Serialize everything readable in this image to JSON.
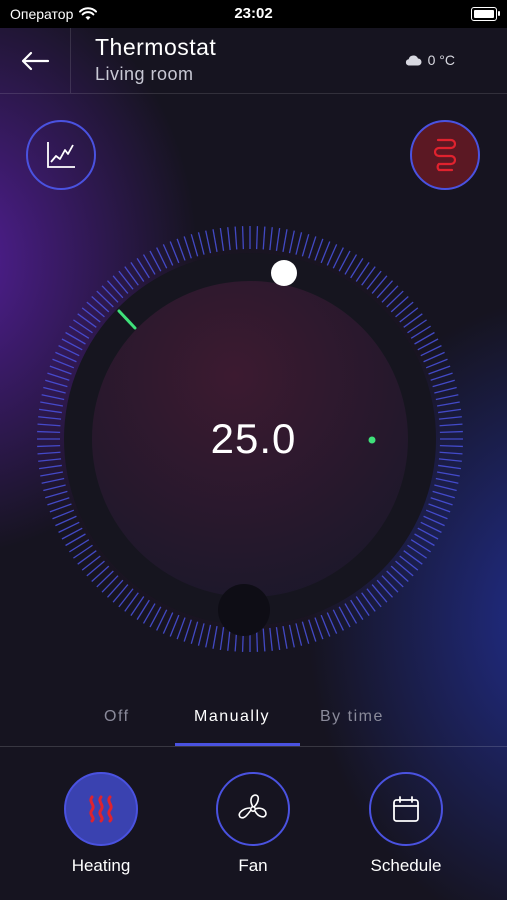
{
  "status_bar": {
    "carrier": "Оператор",
    "time": "23:02"
  },
  "header": {
    "title": "Thermostat",
    "subtitle": "Living room",
    "weather": "0 °C"
  },
  "thermostat": {
    "target_temperature": "25.0"
  },
  "tabs": [
    {
      "label": "Off",
      "active": false
    },
    {
      "label": "Manually",
      "active": true
    },
    {
      "label": "By time",
      "active": false
    }
  ],
  "bottom_bar": [
    {
      "label": "Heating",
      "icon": "heating-icon",
      "active": true
    },
    {
      "label": "Fan",
      "icon": "fan-icon",
      "active": false
    },
    {
      "label": "Schedule",
      "icon": "calendar-icon",
      "active": false
    }
  ],
  "colors": {
    "accent": "#4a52e0",
    "heating_red": "#e0222e",
    "indicator_green": "#3fe07a",
    "background": "#161420"
  }
}
